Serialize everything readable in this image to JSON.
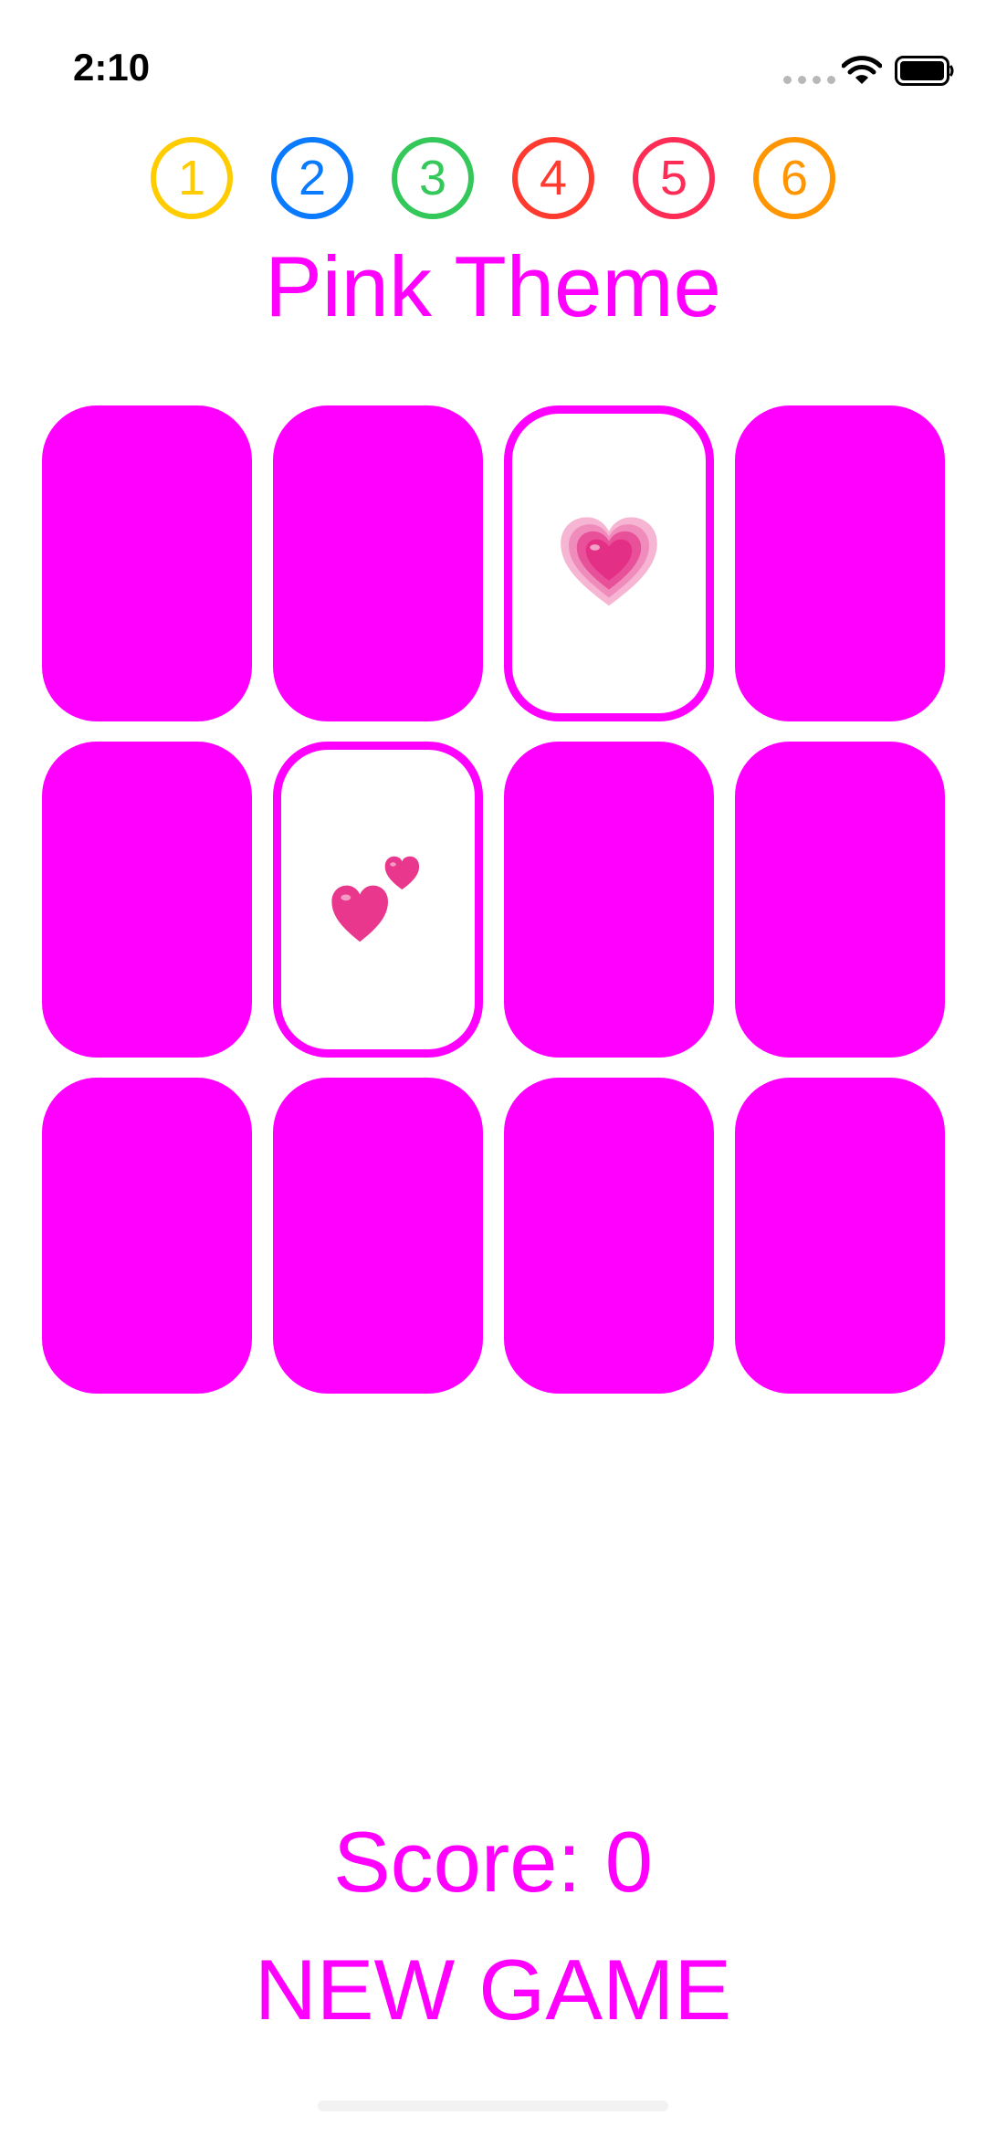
{
  "status_bar": {
    "time": "2:10"
  },
  "theme_selector": {
    "buttons": [
      {
        "label": "1",
        "color": "#ffcc00"
      },
      {
        "label": "2",
        "color": "#0a7aff"
      },
      {
        "label": "3",
        "color": "#34c759"
      },
      {
        "label": "4",
        "color": "#ff3b30"
      },
      {
        "label": "5",
        "color": "#ff2d55"
      },
      {
        "label": "6",
        "color": "#ff9500"
      }
    ]
  },
  "theme_title": "Pink Theme",
  "theme_color": "#ff00ff",
  "cards": [
    {
      "state": "face-down"
    },
    {
      "state": "face-down"
    },
    {
      "state": "face-up",
      "emoji": "growing-heart"
    },
    {
      "state": "face-down"
    },
    {
      "state": "face-down"
    },
    {
      "state": "face-up",
      "emoji": "two-hearts"
    },
    {
      "state": "face-down"
    },
    {
      "state": "face-down"
    },
    {
      "state": "face-down"
    },
    {
      "state": "face-down"
    },
    {
      "state": "face-down"
    },
    {
      "state": "face-down"
    }
  ],
  "score_text": "Score: 0",
  "new_game_label": "NEW GAME"
}
